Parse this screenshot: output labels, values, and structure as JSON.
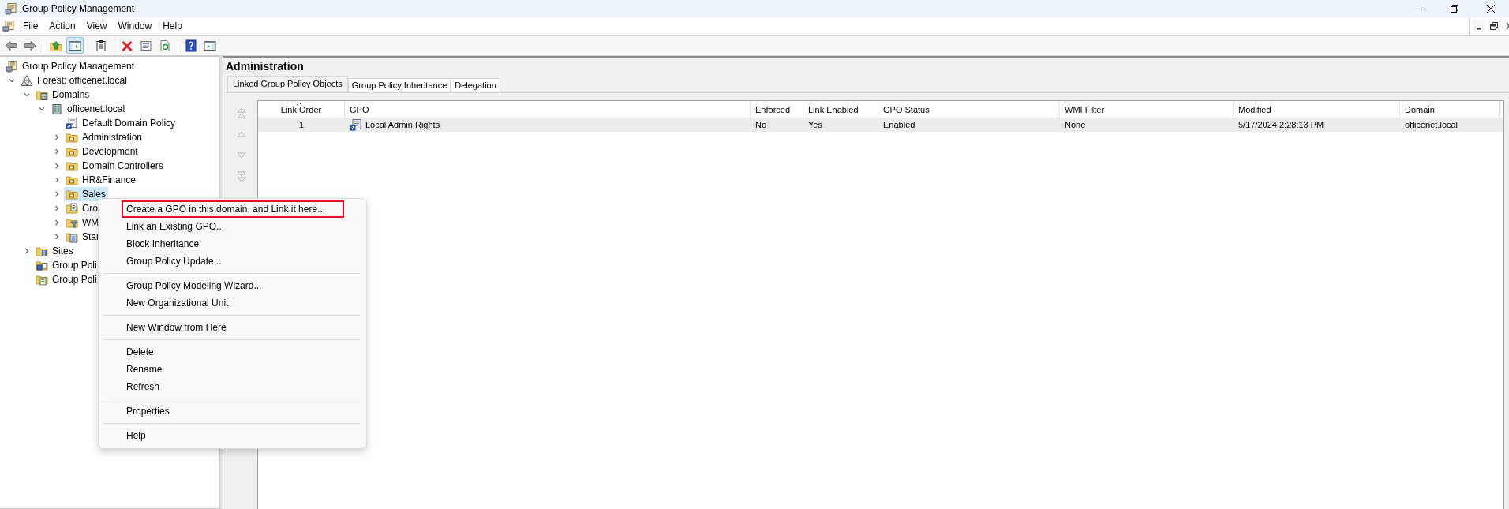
{
  "window": {
    "title": "Group Policy Management"
  },
  "menu_bar": [
    "File",
    "Action",
    "View",
    "Window",
    "Help"
  ],
  "toolbar": [
    {
      "kind": "back",
      "pressed": false
    },
    {
      "kind": "forward",
      "pressed": false
    },
    {
      "kind": "separator"
    },
    {
      "kind": "up",
      "pressed": false
    },
    {
      "kind": "console-tree",
      "pressed": true
    },
    {
      "kind": "separator"
    },
    {
      "kind": "export",
      "pressed": false
    },
    {
      "kind": "separator"
    },
    {
      "kind": "delete",
      "pressed": false
    },
    {
      "kind": "properties",
      "pressed": false
    },
    {
      "kind": "refresh",
      "pressed": false
    },
    {
      "kind": "separator"
    },
    {
      "kind": "help",
      "pressed": false
    },
    {
      "kind": "action-pane",
      "pressed": false
    }
  ],
  "tree": {
    "items": [
      {
        "label": "Group Policy Management",
        "kind": "root",
        "selected": false,
        "children": [
          {
            "label": "Forest: officenet.local",
            "kind": "forest",
            "expanded": true,
            "selected": false,
            "children": [
              {
                "label": "Domains",
                "kind": "domains",
                "expanded": true,
                "selected": false,
                "children": [
                  {
                    "label": "officenet.local",
                    "kind": "domain",
                    "expanded": true,
                    "selected": false,
                    "children": [
                      {
                        "label": "Default Domain Policy",
                        "kind": "link",
                        "selected": false
                      },
                      {
                        "label": "Administration",
                        "kind": "ou",
                        "expanded": false,
                        "selected": false
                      },
                      {
                        "label": "Development",
                        "kind": "ou",
                        "expanded": false,
                        "selected": false
                      },
                      {
                        "label": "Domain Controllers",
                        "kind": "ou",
                        "expanded": false,
                        "selected": false
                      },
                      {
                        "label": "HR&Finance",
                        "kind": "ou",
                        "expanded": false,
                        "selected": false
                      },
                      {
                        "label": "Sales",
                        "kind": "ou",
                        "expanded": false,
                        "selected": true
                      },
                      {
                        "label": "Gro",
                        "kind": "gpos",
                        "expanded": false,
                        "selected": false
                      },
                      {
                        "label": "WM",
                        "kind": "wmi",
                        "expanded": false,
                        "selected": false
                      },
                      {
                        "label": "Star",
                        "kind": "starter",
                        "expanded": false,
                        "selected": false
                      }
                    ]
                  }
                ]
              },
              {
                "label": "Sites",
                "kind": "sites",
                "expanded": false,
                "selected": false
              },
              {
                "label": "Group Poli",
                "kind": "modeling",
                "selected": false
              },
              {
                "label": "Group Poli",
                "kind": "results",
                "selected": false
              }
            ]
          }
        ]
      }
    ]
  },
  "details": {
    "title": "Administration",
    "tabs": [
      {
        "label": "Linked Group Policy Objects",
        "selected": true
      },
      {
        "label": "Group Policy Inheritance",
        "selected": false
      },
      {
        "label": "Delegation",
        "selected": false
      }
    ],
    "columns": [
      {
        "label": "Link Order",
        "sorted": true
      },
      {
        "label": "GPO",
        "sorted": false
      },
      {
        "label": "Enforced",
        "sorted": false
      },
      {
        "label": "Link Enabled",
        "sorted": false
      },
      {
        "label": "GPO Status",
        "sorted": false
      },
      {
        "label": "WMI Filter",
        "sorted": false
      },
      {
        "label": "Modified",
        "sorted": false
      },
      {
        "label": "Domain",
        "sorted": false
      }
    ],
    "rows": [
      {
        "selected": true,
        "cells": [
          "1",
          "Local Admin Rights",
          "No",
          "Yes",
          "Enabled",
          "None",
          "5/17/2024 2:28:13 PM",
          "officenet.local"
        ]
      }
    ]
  },
  "context_menu": {
    "items": [
      {
        "kind": "item",
        "label": "Create a GPO in this domain, and Link it here...",
        "highlighted": true
      },
      {
        "kind": "item",
        "label": "Link an Existing GPO...",
        "highlighted": false
      },
      {
        "kind": "item",
        "label": "Block Inheritance",
        "highlighted": false
      },
      {
        "kind": "item",
        "label": "Group Policy Update...",
        "highlighted": false
      },
      {
        "kind": "separator"
      },
      {
        "kind": "item",
        "label": "Group Policy Modeling Wizard...",
        "highlighted": false
      },
      {
        "kind": "item",
        "label": "New Organizational Unit",
        "highlighted": false
      },
      {
        "kind": "separator"
      },
      {
        "kind": "item",
        "label": "New Window from Here",
        "highlighted": false
      },
      {
        "kind": "separator"
      },
      {
        "kind": "item",
        "label": "Delete",
        "highlighted": false
      },
      {
        "kind": "item",
        "label": "Rename",
        "highlighted": false
      },
      {
        "kind": "item",
        "label": "Refresh",
        "highlighted": false
      },
      {
        "kind": "separator"
      },
      {
        "kind": "item",
        "label": "Properties",
        "highlighted": false
      },
      {
        "kind": "separator"
      },
      {
        "kind": "item",
        "label": "Help",
        "highlighted": false
      }
    ]
  }
}
